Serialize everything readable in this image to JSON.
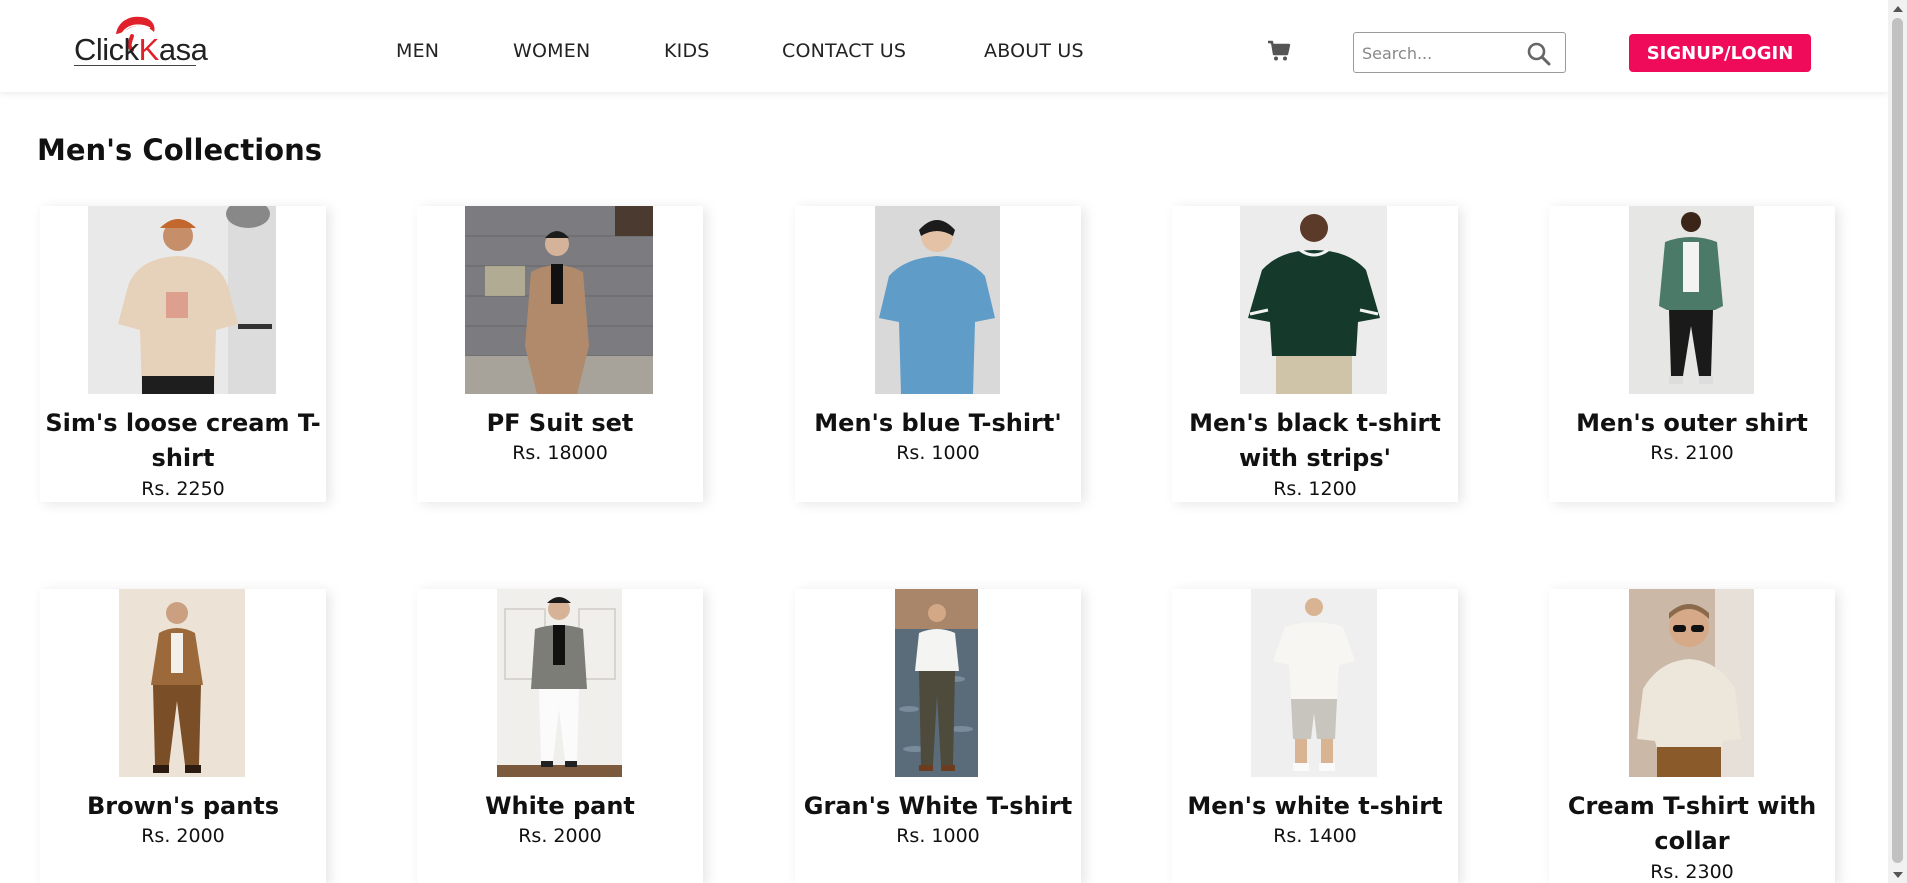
{
  "brand": {
    "logo_text": "ClickKasa",
    "accent_color": "#ef0a5a",
    "logo_color": "#e0202a"
  },
  "nav": {
    "items": [
      {
        "label": "MEN"
      },
      {
        "label": "WOMEN"
      },
      {
        "label": "KIDS"
      },
      {
        "label": "CONTACT US"
      },
      {
        "label": "ABOUT US"
      }
    ]
  },
  "header": {
    "cart_icon": "shopping-cart-icon",
    "search": {
      "placeholder": "Search...",
      "value": "",
      "icon": "search-icon"
    },
    "signup_label": "SIGNUP/LOGIN"
  },
  "main": {
    "title": "Men's Collections",
    "products": [
      {
        "name": "Sim's loose cream T-shirt",
        "price": "Rs. 2250"
      },
      {
        "name": "PF Suit set",
        "price": "Rs. 18000"
      },
      {
        "name": "Men's blue T-shirt'",
        "price": "Rs. 1000"
      },
      {
        "name": "Men's black t-shirt with strips'",
        "price": "Rs. 1200"
      },
      {
        "name": "Men's outer shirt",
        "price": "Rs. 2100"
      },
      {
        "name": "Brown's pants",
        "price": "Rs. 2000"
      },
      {
        "name": "White pant",
        "price": "Rs. 2000"
      },
      {
        "name": "Gran's White T-shirt",
        "price": "Rs. 1000"
      },
      {
        "name": "Men's white t-shirt",
        "price": "Rs. 1400"
      },
      {
        "name": "Cream T-shirt with collar",
        "price": "Rs. 2300"
      }
    ]
  }
}
